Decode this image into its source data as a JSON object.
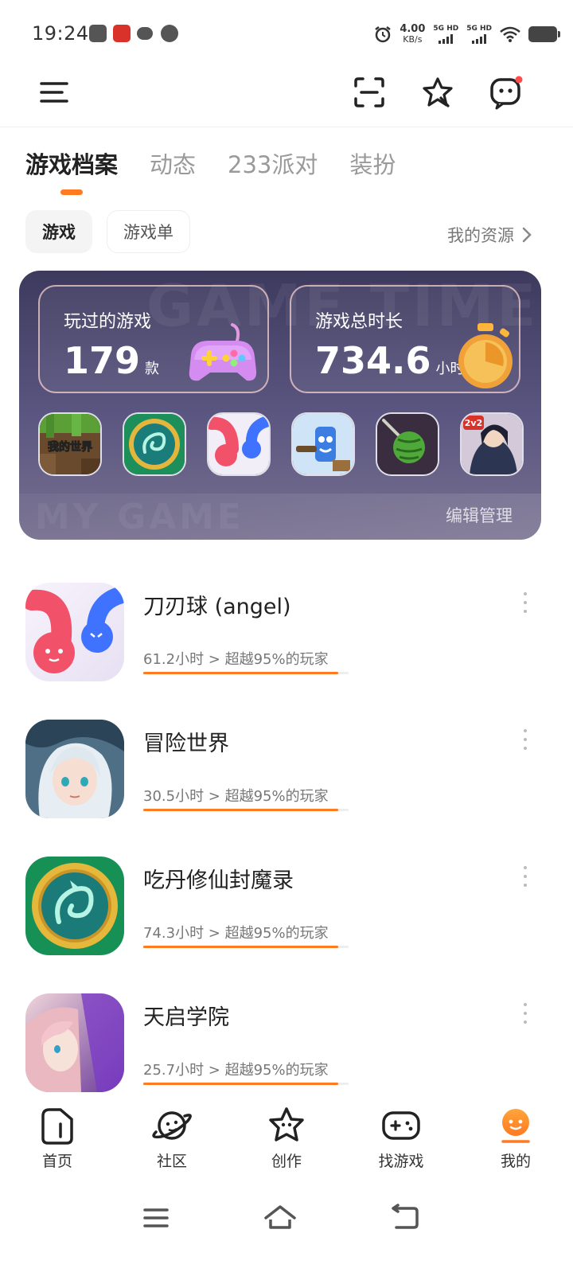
{
  "status_bar": {
    "time": "19:24",
    "net_speed": "4.00",
    "net_unit": "KB/s",
    "sim1": "5G HD",
    "sim2": "5G HD"
  },
  "tabs": [
    "游戏档案",
    "动态",
    "233派对",
    "装扮"
  ],
  "sub_tabs": [
    "游戏",
    "游戏单"
  ],
  "my_resources": "我的资源",
  "card": {
    "bg_top": "GAME TIME",
    "bg_bottom": "MY GAME",
    "played": {
      "label": "玩过的游戏",
      "value": "179",
      "unit": "款"
    },
    "duration": {
      "label": "游戏总时长",
      "value": "734.6",
      "unit": "小时"
    },
    "mini_games": [
      "我的世界",
      "dragon",
      "angel",
      "cartoon",
      "melon",
      "2v2"
    ],
    "mini_text": "我的世界",
    "mini_badge": "2v2",
    "edit": "编辑管理"
  },
  "games": [
    {
      "name": "刀刃球 (angel)",
      "meta": "61.2小时 > 超越95%的玩家",
      "percent": 95
    },
    {
      "name": "冒险世界",
      "meta": "30.5小时 > 超越95%的玩家",
      "percent": 95
    },
    {
      "name": "吃丹修仙封魔录",
      "meta": "74.3小时 > 超越95%的玩家",
      "percent": 95
    },
    {
      "name": "天启学院",
      "meta": "25.7小时 > 超越95%的玩家",
      "percent": 95
    }
  ],
  "nav": [
    {
      "label": "首页",
      "icon": "home-icon"
    },
    {
      "label": "社区",
      "icon": "planet-icon"
    },
    {
      "label": "创作",
      "icon": "star-face-icon"
    },
    {
      "label": "找游戏",
      "icon": "gamepad-icon"
    },
    {
      "label": "我的",
      "icon": "profile-icon"
    }
  ],
  "colors": {
    "accent": "#ff7a21",
    "card_bg": "#4a4670"
  }
}
